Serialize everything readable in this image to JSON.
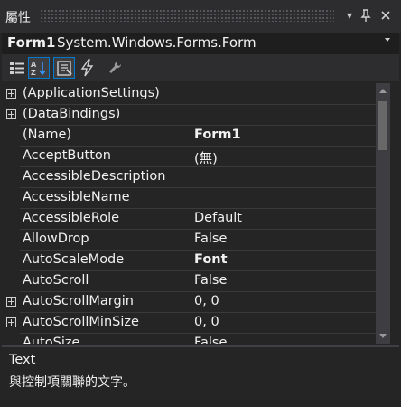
{
  "window": {
    "title": "屬性"
  },
  "title_buttons": [
    {
      "name": "dropdown-icon",
      "glyph": "▾"
    },
    {
      "name": "pin-icon",
      "glyph": "📌"
    },
    {
      "name": "close-icon",
      "glyph": "✕"
    }
  ],
  "object_selector": {
    "object_name": "Form1",
    "object_type": "System.Windows.Forms.Form"
  },
  "toolbar": {
    "buttons": [
      {
        "name": "categorized-icon",
        "active": false
      },
      {
        "name": "alphabetical-icon",
        "active": true
      },
      {
        "name": "properties-icon",
        "active": true
      },
      {
        "name": "events-icon",
        "active": false
      },
      {
        "name": "property-pages-icon",
        "active": false
      }
    ]
  },
  "properties": [
    {
      "name": "(ApplicationSettings)",
      "value": "",
      "expandable": true,
      "bold": false
    },
    {
      "name": "(DataBindings)",
      "value": "",
      "expandable": true,
      "bold": false
    },
    {
      "name": "(Name)",
      "value": "Form1",
      "expandable": false,
      "bold": true
    },
    {
      "name": "AcceptButton",
      "value": "(無)",
      "expandable": false,
      "bold": false
    },
    {
      "name": "AccessibleDescription",
      "value": "",
      "expandable": false,
      "bold": false
    },
    {
      "name": "AccessibleName",
      "value": "",
      "expandable": false,
      "bold": false
    },
    {
      "name": "AccessibleRole",
      "value": "Default",
      "expandable": false,
      "bold": false
    },
    {
      "name": "AllowDrop",
      "value": "False",
      "expandable": false,
      "bold": false
    },
    {
      "name": "AutoScaleMode",
      "value": "Font",
      "expandable": false,
      "bold": true
    },
    {
      "name": "AutoScroll",
      "value": "False",
      "expandable": false,
      "bold": false
    },
    {
      "name": "AutoScrollMargin",
      "value": "0, 0",
      "expandable": true,
      "bold": false
    },
    {
      "name": "AutoScrollMinSize",
      "value": "0, 0",
      "expandable": true,
      "bold": false
    },
    {
      "name": "AutoSize",
      "value": "False",
      "expandable": false,
      "bold": false
    }
  ],
  "description": {
    "title": "Text",
    "text": "與控制項關聯的文字。"
  },
  "colors": {
    "background": "#252526",
    "accent": "#007acc",
    "text": "#f1f1f1"
  }
}
